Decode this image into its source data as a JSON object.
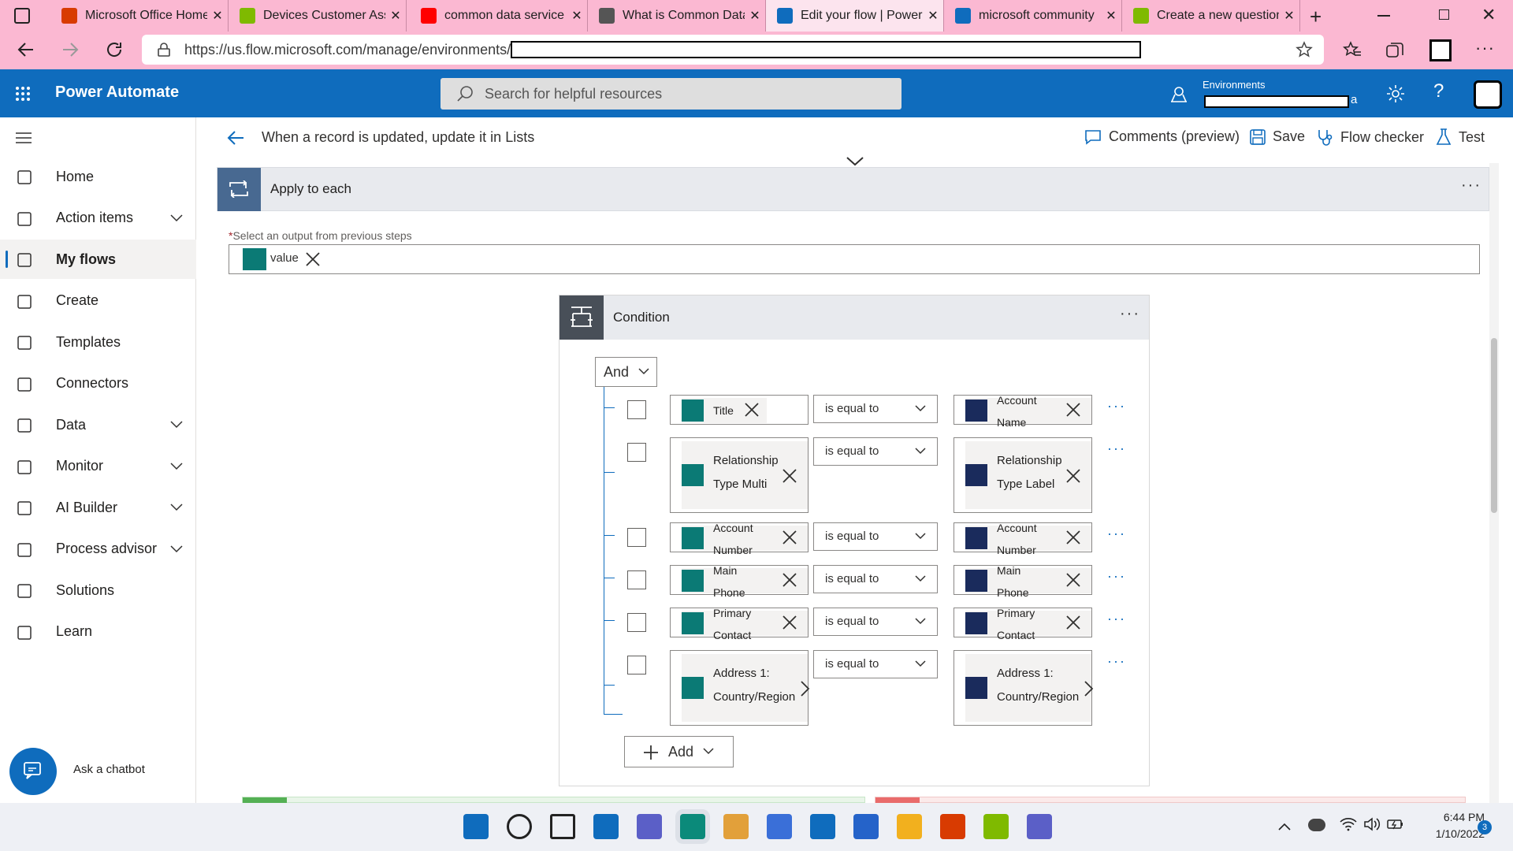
{
  "browser": {
    "tabs": [
      {
        "label": "Microsoft Office Home",
        "icon": "office-icon",
        "color": "#d83b01"
      },
      {
        "label": "Devices Customer Ass",
        "icon": "microsoft-logo-icon",
        "color": "#7fba00"
      },
      {
        "label": "common data service",
        "icon": "youtube-icon",
        "color": "#ff0000"
      },
      {
        "label": "What is Common Data",
        "icon": "docs-icon",
        "color": "#555555"
      },
      {
        "label": "Edit your flow | Power",
        "icon": "power-automate-icon",
        "color": "#0f6cbd"
      },
      {
        "label": "microsoft community",
        "icon": "bing-icon",
        "color": "#0f6cbd"
      },
      {
        "label": "Create a new question",
        "icon": "microsoft-logo-icon",
        "color": "#7fba00"
      }
    ],
    "url": "https://us.flow.microsoft.com/manage/environments/"
  },
  "app": {
    "name": "Power Automate",
    "search_placeholder": "Search for helpful resources",
    "env_label": "Environments",
    "env_suffix": "a",
    "accent": "#0f6cbd"
  },
  "sidebar": {
    "items": [
      {
        "label": "Home",
        "icon": "home-icon",
        "chevron": false
      },
      {
        "label": "Action items",
        "icon": "clipboard-icon",
        "chevron": true
      },
      {
        "label": "My flows",
        "icon": "flow-icon",
        "chevron": false,
        "selected": true
      },
      {
        "label": "Create",
        "icon": "plus-icon",
        "chevron": false
      },
      {
        "label": "Templates",
        "icon": "templates-icon",
        "chevron": false
      },
      {
        "label": "Connectors",
        "icon": "connector-icon",
        "chevron": false
      },
      {
        "label": "Data",
        "icon": "database-icon",
        "chevron": true
      },
      {
        "label": "Monitor",
        "icon": "monitor-icon",
        "chevron": true
      },
      {
        "label": "AI Builder",
        "icon": "ai-builder-icon",
        "chevron": true
      },
      {
        "label": "Process advisor",
        "icon": "process-advisor-icon",
        "chevron": true
      },
      {
        "label": "Solutions",
        "icon": "solutions-icon",
        "chevron": false
      },
      {
        "label": "Learn",
        "icon": "book-icon",
        "chevron": false
      }
    ],
    "chatbot_label": "Ask a chatbot"
  },
  "cmdbar": {
    "flow_title": "When a record is updated, update it in Lists",
    "comments": "Comments (preview)",
    "save": "Save",
    "flow_checker": "Flow checker",
    "test": "Test"
  },
  "apply_each": {
    "title": "Apply to each",
    "field_label": "Select an output from previous steps",
    "token": "value"
  },
  "condition": {
    "title": "Condition",
    "group_op": "And",
    "add_label": "Add",
    "rows": [
      {
        "left": [
          "Title"
        ],
        "op": "is equal to",
        "right": [
          "Account",
          "Name"
        ]
      },
      {
        "left": [
          "Relationship",
          "Type Multi"
        ],
        "op": "is equal to",
        "right": [
          "Relationship",
          "Type Label"
        ]
      },
      {
        "left": [
          "Account",
          "Number"
        ],
        "op": "is equal to",
        "right": [
          "Account",
          "Number"
        ]
      },
      {
        "left": [
          "Main",
          "Phone"
        ],
        "op": "is equal to",
        "right": [
          "Main",
          "Phone"
        ]
      },
      {
        "left": [
          "Primary",
          "Contact"
        ],
        "op": "is equal to",
        "right": [
          "Primary",
          "Contact"
        ]
      },
      {
        "left": [
          "Address 1:",
          "Country/Region"
        ],
        "op": "is equal to",
        "right": [
          "Address 1:",
          "Country/Region"
        ]
      }
    ]
  },
  "taskbar": {
    "time": "6:44 PM",
    "date": "1/10/2022",
    "notifications": "3",
    "apps": [
      "windows-start-icon",
      "search-icon",
      "task-view-icon",
      "widgets-icon",
      "teams-chat-icon",
      "edge-icon",
      "chrome-icon",
      "store-icon",
      "mail-icon",
      "edge-dev-icon",
      "file-explorer-icon",
      "office-icon",
      "paint-icon",
      "teams-icon"
    ]
  }
}
